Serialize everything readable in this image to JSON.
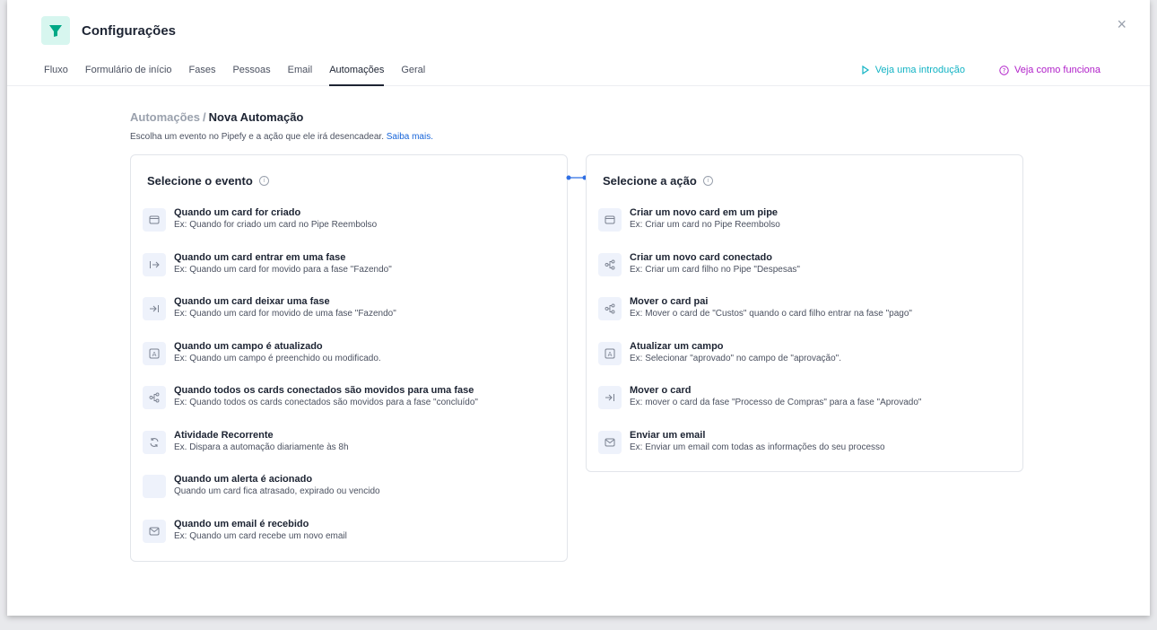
{
  "header": {
    "title": "Configurações",
    "close_symbol": "×",
    "tabs": [
      {
        "label": "Fluxo",
        "active": false
      },
      {
        "label": "Formulário de início",
        "active": false
      },
      {
        "label": "Fases",
        "active": false
      },
      {
        "label": "Pessoas",
        "active": false
      },
      {
        "label": "Email",
        "active": false
      },
      {
        "label": "Automações",
        "active": true
      },
      {
        "label": "Geral",
        "active": false
      }
    ],
    "intro_link": "Veja uma introdução",
    "how_link": "Veja como funciona"
  },
  "breadcrumb": {
    "parent": "Automações",
    "separator": "/",
    "current": "Nova Automação"
  },
  "subtitle": {
    "text": "Escolha um evento no Pipefy e a ação que ele irá desencadear. ",
    "link": "Saiba mais."
  },
  "events": {
    "title": "Selecione o evento",
    "items": [
      {
        "icon": "card-icon",
        "title": "Quando um card for criado",
        "desc": "Ex: Quando for criado um card no Pipe Reembolso"
      },
      {
        "icon": "enter-phase-icon",
        "title": "Quando um card entrar em uma fase",
        "desc": "Ex: Quando um card for movido para a fase \"Fazendo\""
      },
      {
        "icon": "leave-phase-icon",
        "title": "Quando um card deixar uma fase",
        "desc": "Ex: Quando um card for movido de uma fase \"Fazendo\""
      },
      {
        "icon": "field-icon",
        "title": "Quando um campo é atualizado",
        "desc": "Ex: Quando um campo é preenchido ou modificado."
      },
      {
        "icon": "connection-icon",
        "title": "Quando todos os cards conectados são movidos para uma fase",
        "desc": "Ex: Quando todos os cards conectados são movidos para a fase \"concluído\""
      },
      {
        "icon": "recurring-icon",
        "title": "Atividade Recorrente",
        "desc": "Ex. Dispara a automação diariamente às 8h"
      },
      {
        "icon": "alert-icon",
        "title": "Quando um alerta é acionado",
        "desc": "Quando um card fica atrasado, expirado ou vencido"
      },
      {
        "icon": "email-icon",
        "title": "Quando um email é recebido",
        "desc": "Ex: Quando um card recebe um novo email"
      }
    ]
  },
  "actions": {
    "title": "Selecione a ação",
    "items": [
      {
        "icon": "card-icon",
        "title": "Criar um novo card em um pipe",
        "desc": "Ex: Criar um card no Pipe Reembolso"
      },
      {
        "icon": "connection-icon",
        "title": "Criar um novo card conectado",
        "desc": "Ex: Criar um card filho no Pipe \"Despesas\""
      },
      {
        "icon": "connection-icon",
        "title": "Mover o card pai",
        "desc": "Ex: Mover o card de \"Custos\" quando o card filho entrar na fase \"pago\""
      },
      {
        "icon": "field-icon",
        "title": "Atualizar um campo",
        "desc": "Ex: Selecionar \"aprovado\" no campo de \"aprovação\"."
      },
      {
        "icon": "leave-phase-icon",
        "title": "Mover o card",
        "desc": "Ex: mover o card da fase \"Processo de Compras\" para a fase \"Aprovado\""
      },
      {
        "icon": "email-icon",
        "title": "Enviar um email",
        "desc": "Ex: Enviar um email com todas as informações do seu processo"
      }
    ]
  },
  "colors": {
    "accent_teal": "#12b3c4",
    "accent_purple": "#b01fc9",
    "link_blue": "#1664d9",
    "connector_blue": "#2f6fe4"
  }
}
